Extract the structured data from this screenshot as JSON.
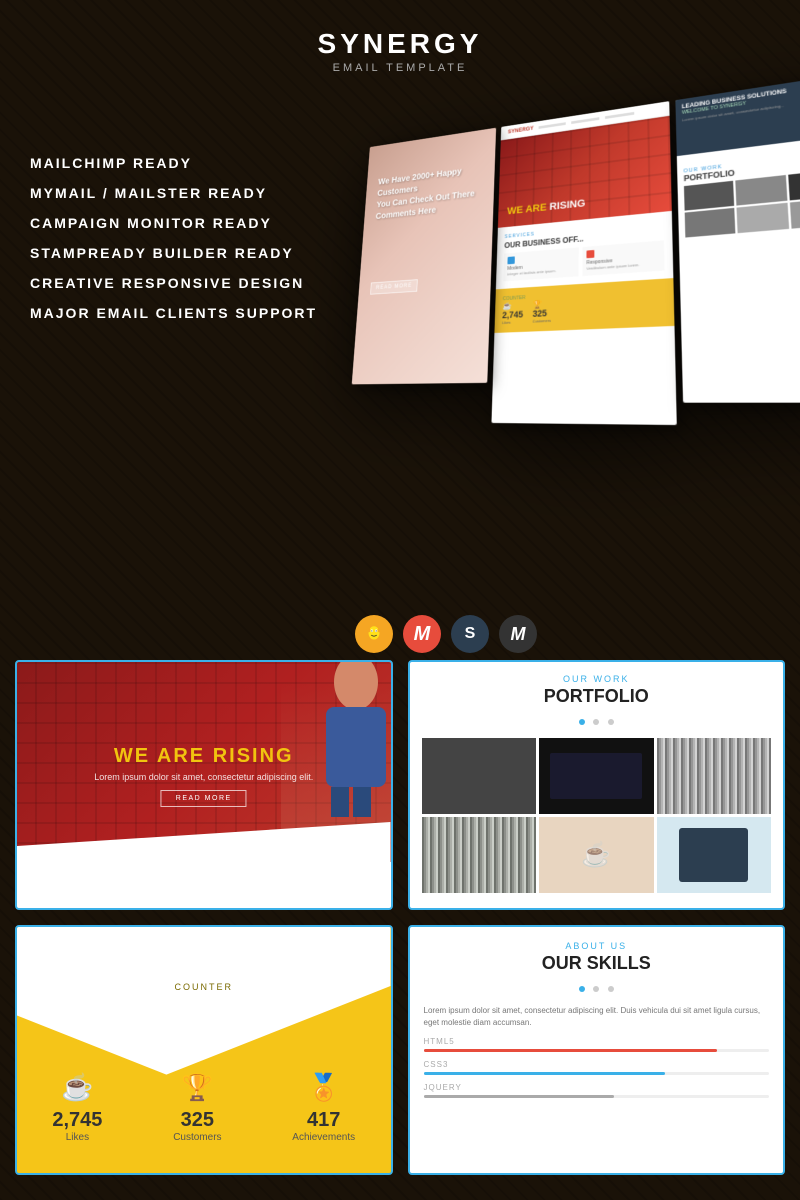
{
  "header": {
    "title": "SYNERGY",
    "subtitle": "EMAIL TEMPLATE"
  },
  "features": [
    "MAILCHIMP READY",
    "MYMAIL / MAILSTER READY",
    "CAMPAIGN MONITOR READY",
    "STAMPREADY BUILDER READY",
    "CREATIVE RESPONSIVE DESIGN",
    "MAJOR EMAIL CLIENTS SUPPORT"
  ],
  "hero": {
    "we_are": "WE ARE",
    "rising": "RISING",
    "desc": "Lorem ipsum dolor sit amet, consectetur adipiscing elit.",
    "btn": "READ MORE"
  },
  "portfolio": {
    "eyebrow": "OUR WORK",
    "heading": "PORTFOLIO"
  },
  "counter": {
    "eyebrow": "COUNTER",
    "items": [
      {
        "icon": "☕",
        "number": "2,745",
        "label": "Likes"
      },
      {
        "icon": "🏆",
        "number": "325",
        "label": "Customers"
      },
      {
        "icon": "🏅",
        "number": "417",
        "label": "Achievements"
      }
    ]
  },
  "skills": {
    "eyebrow": "ABOUT US",
    "heading": "OUR SKILLS",
    "text": "Lorem ipsum dolor sit amet, consectetur adipiscing elit. Duis vehicula dui sit amet ligula cursus, eget molestie diam accumsan.",
    "items": [
      {
        "label": "HTML5",
        "pct": 85,
        "color": "bar-red"
      },
      {
        "label": "CSS3",
        "pct": 70,
        "color": "bar-blue"
      },
      {
        "label": "JQUERY",
        "pct": 55,
        "color": "bar-gray"
      }
    ]
  },
  "icons": [
    {
      "type": "monkey",
      "label": "MailChimp"
    },
    {
      "type": "m-red",
      "label": "MyMail"
    },
    {
      "type": "s-dark",
      "label": "StampReady"
    },
    {
      "type": "m-dark",
      "label": "Mailster"
    }
  ]
}
